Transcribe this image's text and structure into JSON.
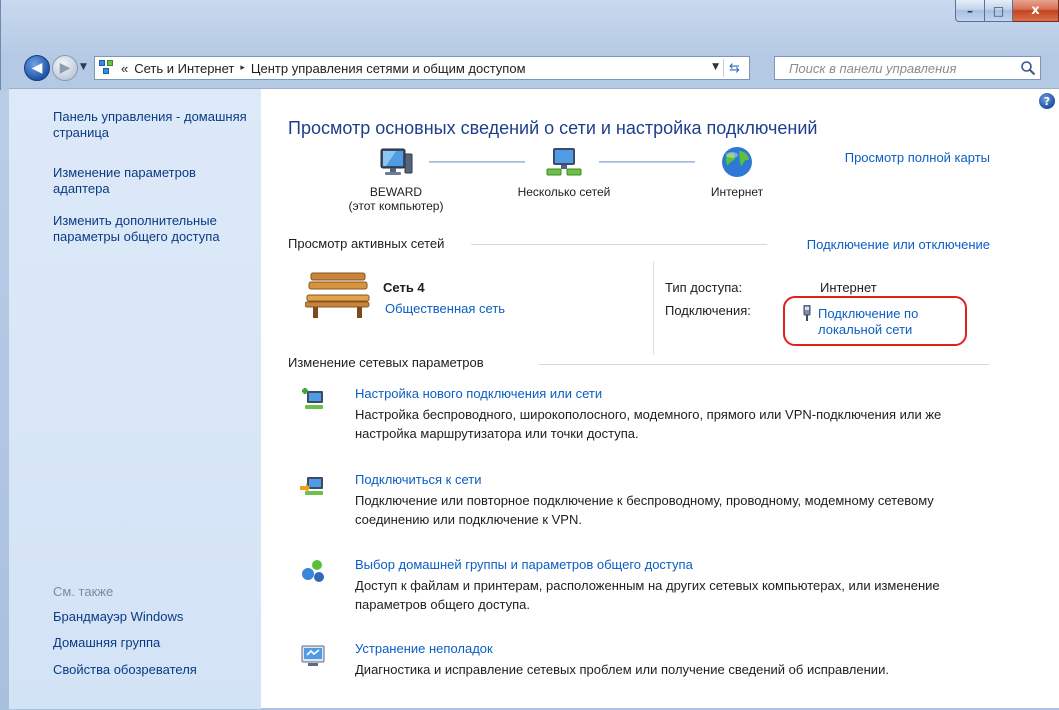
{
  "window": {
    "caption": {
      "minimize": "–",
      "maximize": "□",
      "close": "x"
    }
  },
  "address_bar": {
    "prefix": "«",
    "breadcrumb": [
      "Сеть и Интернет",
      "Центр управления сетями и общим доступом"
    ],
    "separator": "▸"
  },
  "search": {
    "placeholder": "Поиск в панели управления"
  },
  "sidebar": {
    "links": [
      "Панель управления - домашняя страница",
      "Изменение параметров адаптера",
      "Изменить дополнительные параметры общего доступа"
    ],
    "see_also_heading": "См. также",
    "see_also": [
      "Брандмауэр Windows",
      "Домашняя группа",
      "Свойства обозревателя"
    ]
  },
  "main": {
    "title": "Просмотр основных сведений о сети и настройка подключений",
    "map": {
      "computer_name": "BEWARD",
      "computer_sub": "(этот компьютер)",
      "networks_label": "Несколько сетей",
      "internet_label": "Интернет",
      "full_map_link": "Просмотр полной карты"
    },
    "active_networks": {
      "heading": "Просмотр активных сетей",
      "action_link": "Подключение или отключение",
      "network_name": "Сеть 4",
      "network_type": "Общественная сеть",
      "access_type_label": "Тип доступа:",
      "access_type_value": "Интернет",
      "connections_label": "Подключения:",
      "connection_link": "Подключение по локальной сети"
    },
    "change_settings": {
      "heading": "Изменение сетевых параметров",
      "tasks": [
        {
          "title": "Настройка нового подключения или сети",
          "desc": "Настройка беспроводного, широкополосного, модемного, прямого или VPN-подключения или же настройка маршрутизатора или точки доступа."
        },
        {
          "title": "Подключиться к сети",
          "desc": "Подключение или повторное подключение к беспроводному, проводному, модемному сетевому соединению или подключение к VPN."
        },
        {
          "title": "Выбор домашней группы и параметров общего доступа",
          "desc": "Доступ к файлам и принтерам, расположенным на других сетевых компьютерах, или изменение параметров общего доступа."
        },
        {
          "title": "Устранение неполадок",
          "desc": "Диагностика и исправление сетевых проблем или получение сведений об исправлении."
        }
      ]
    }
  }
}
